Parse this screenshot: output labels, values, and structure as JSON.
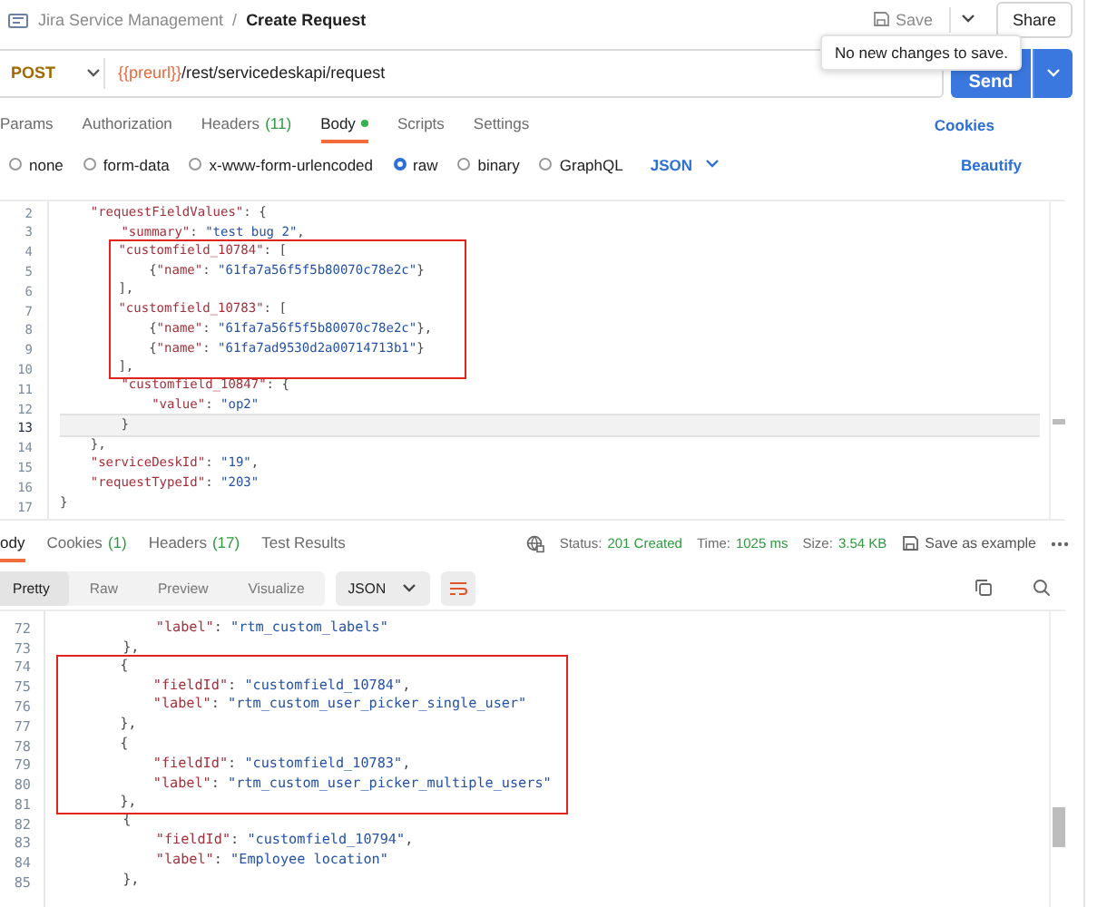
{
  "breadcrumb": {
    "workspace": "Jira Service Management",
    "separator": "/",
    "request": "Create Request"
  },
  "header_actions": {
    "save": "Save",
    "share": "Share"
  },
  "tooltip": "No new changes to save.",
  "url_bar": {
    "method": "POST",
    "variable": "{{preurl}}",
    "path": "/rest/servicedeskapi/request",
    "send": "Send"
  },
  "request_tabs": [
    {
      "label": "Params",
      "selected": false,
      "modified": false
    },
    {
      "label": "Authorization",
      "selected": false,
      "modified": false
    },
    {
      "label": "Headers",
      "count": "(11)",
      "selected": false,
      "modified": false
    },
    {
      "label": "Body",
      "selected": true,
      "modified": true
    },
    {
      "label": "Scripts",
      "selected": false,
      "modified": false
    },
    {
      "label": "Settings",
      "selected": false,
      "modified": false
    }
  ],
  "cookies_link": "Cookies",
  "body_types": [
    {
      "label": "none",
      "selected": false
    },
    {
      "label": "form-data",
      "selected": false
    },
    {
      "label": "x-www-form-urlencoded",
      "selected": false
    },
    {
      "label": "raw",
      "selected": true
    },
    {
      "label": "binary",
      "selected": false
    },
    {
      "label": "GraphQL",
      "selected": false
    }
  ],
  "body_format": "JSON",
  "beautify": "Beautify",
  "request_editor": {
    "blocks": [
      {
        "boxed": false,
        "lines": [
          {
            "number": "2",
            "text": "    \"requestFieldValues\": {",
            "current": false
          },
          {
            "number": "3",
            "text": "        \"summary\": \"test bug 2\",",
            "current": false
          }
        ]
      },
      {
        "boxed": true,
        "lines": [
          {
            "number": "4",
            "text": "        \"customfield_10784\": [",
            "current": false
          },
          {
            "number": "5",
            "text": "            {\"name\": \"61fa7a56f5f5b80070c78e2c\"}",
            "current": false
          },
          {
            "number": "6",
            "text": "        ],",
            "current": false
          },
          {
            "number": "7",
            "text": "        \"customfield_10783\": [",
            "current": false
          },
          {
            "number": "8",
            "text": "            {\"name\": \"61fa7a56f5f5b80070c78e2c\"},",
            "current": false
          },
          {
            "number": "9",
            "text": "            {\"name\": \"61fa7ad9530d2a00714713b1\"}",
            "current": false
          },
          {
            "number": "10",
            "text": "        ],",
            "current": false
          }
        ]
      },
      {
        "boxed": false,
        "lines": [
          {
            "number": "11",
            "text": "        \"customfield_10847\": {",
            "current": false
          },
          {
            "number": "12",
            "text": "            \"value\": \"op2\"",
            "current": false
          },
          {
            "number": "13",
            "text": "        }",
            "current": true
          },
          {
            "number": "14",
            "text": "    },",
            "current": false
          },
          {
            "number": "15",
            "text": "    \"serviceDeskId\": \"19\",",
            "current": false
          },
          {
            "number": "16",
            "text": "    \"requestTypeId\": \"203\"",
            "current": false
          },
          {
            "number": "17",
            "text": "}",
            "current": false
          }
        ]
      }
    ]
  },
  "response_tabs": [
    {
      "label": "ody",
      "selected": true
    },
    {
      "label": "Cookies",
      "count": "(1)",
      "selected": false
    },
    {
      "label": "Headers",
      "count": "(17)",
      "selected": false
    },
    {
      "label": "Test Results",
      "selected": false
    }
  ],
  "response_meta": {
    "status_label": "Status:",
    "status": "201 Created",
    "time_label": "Time:",
    "time": "1025 ms",
    "size_label": "Size:",
    "size": "3.54 KB",
    "save_example": "Save as example"
  },
  "view_modes": [
    {
      "label": "Pretty",
      "selected": true
    },
    {
      "label": "Raw",
      "selected": false
    },
    {
      "label": "Preview",
      "selected": false
    },
    {
      "label": "Visualize",
      "selected": false
    }
  ],
  "response_format": "JSON",
  "response_editor": {
    "blocks": [
      {
        "boxed": false,
        "lines": [
          {
            "number": "72",
            "text": "            \"label\": \"rtm_custom_labels\""
          },
          {
            "number": "73",
            "text": "        },"
          }
        ]
      },
      {
        "boxed": true,
        "lines": [
          {
            "number": "74",
            "text": "        {"
          },
          {
            "number": "75",
            "text": "            \"fieldId\": \"customfield_10784\","
          },
          {
            "number": "76",
            "text": "            \"label\": \"rtm_custom_user_picker_single_user\""
          },
          {
            "number": "77",
            "text": "        },"
          },
          {
            "number": "78",
            "text": "        {"
          },
          {
            "number": "79",
            "text": "            \"fieldId\": \"customfield_10783\","
          },
          {
            "number": "80",
            "text": "            \"label\": \"rtm_custom_user_picker_multiple_users\""
          },
          {
            "number": "81",
            "text": "        },"
          }
        ]
      },
      {
        "boxed": false,
        "lines": [
          {
            "number": "82",
            "text": "        {"
          },
          {
            "number": "83",
            "text": "            \"fieldId\": \"customfield_10794\","
          },
          {
            "number": "84",
            "text": "            \"label\": \"Employee location\""
          },
          {
            "number": "85",
            "text": "        },"
          }
        ]
      }
    ]
  }
}
